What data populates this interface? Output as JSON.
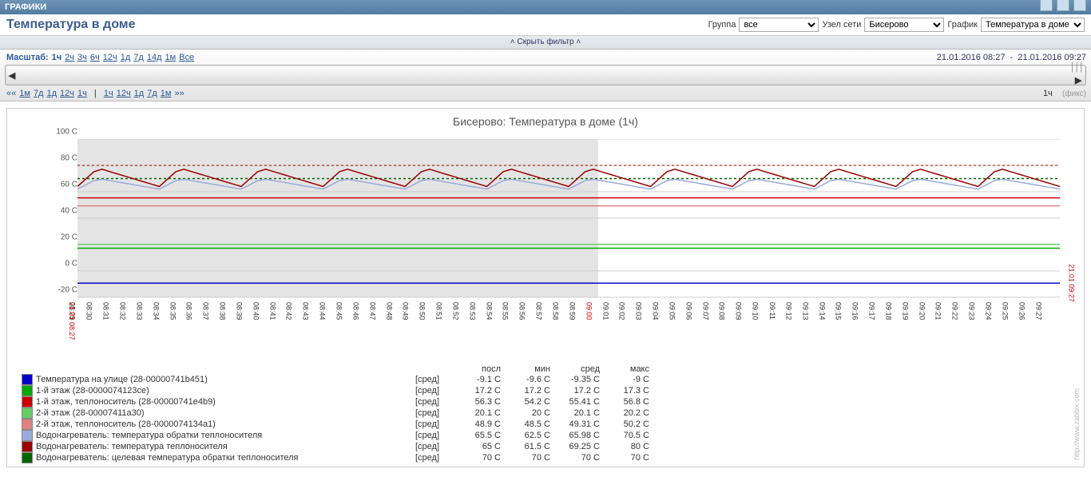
{
  "window_title": "ГРАФИКИ",
  "page_title": "Температура в доме",
  "filters": {
    "group_label": "Группа",
    "group_value": "все",
    "node_label": "Узел сети",
    "node_value": "Бисерово",
    "chart_label": "График",
    "chart_value": "Температура в доме"
  },
  "filterbar_text": "Скрыть фильтр",
  "scale": {
    "label": "Масштаб:",
    "options": [
      "1ч",
      "2ч",
      "3ч",
      "6ч",
      "12ч",
      "1д",
      "7д",
      "14д",
      "1м",
      "Все"
    ],
    "selected": "1ч",
    "date_from": "21.01.2016 08:27",
    "date_sep": "-",
    "date_to": "21.01.2016 09:27"
  },
  "nav2": {
    "back": [
      "««",
      "1м",
      "7д",
      "1д",
      "12ч",
      "1ч"
    ],
    "fwd": [
      "1ч",
      "12ч",
      "1д",
      "7д",
      "1м",
      "»»"
    ],
    "right_label": "1ч",
    "fix": "(фикс)"
  },
  "chart_data": {
    "type": "line",
    "title": "Бисерово: Температура в доме (1ч)",
    "ylabel": "",
    "y_ticks": [
      "-20 C",
      "0 C",
      "20 C",
      "40 C",
      "60 C",
      "80 C",
      "100 C"
    ],
    "ylim": [
      -20,
      100
    ],
    "x_start_label": "21.01 08:27",
    "x_end_label": "21.01 09:27",
    "x_ticks": [
      "08:29",
      "08:30",
      "08:31",
      "08:32",
      "08:33",
      "08:34",
      "08:35",
      "08:36",
      "08:37",
      "08:38",
      "08:39",
      "08:40",
      "08:41",
      "08:42",
      "08:43",
      "08:44",
      "08:45",
      "08:46",
      "08:47",
      "08:48",
      "08:49",
      "08:50",
      "08:51",
      "08:52",
      "08:53",
      "08:54",
      "08:55",
      "08:56",
      "08:57",
      "08:58",
      "08:59",
      "09:00",
      "09:01",
      "09:02",
      "09:03",
      "09:04",
      "09:05",
      "09:06",
      "09:07",
      "09:08",
      "09:09",
      "09:10",
      "09:11",
      "09:12",
      "09:13",
      "09:14",
      "09:15",
      "09:16",
      "09:17",
      "09:18",
      "09:19",
      "09:20",
      "09:21",
      "09:22",
      "09:23",
      "09:24",
      "09:25",
      "09:26",
      "09:27"
    ],
    "x_red_index": 31,
    "shaded_fraction": 0.53,
    "series": [
      {
        "name": "Температура на улице (28-00000741b451)",
        "color": "#0000cc",
        "kind": "[сред]",
        "last": "-9.1 C",
        "min": "-9.6 C",
        "avg": "-9.35 C",
        "max": "-9 C",
        "avg_value": -9.35
      },
      {
        "name": "1-й этаж (28-0000074123ce)",
        "color": "#00aa00",
        "kind": "[сред]",
        "last": "17.2 C",
        "min": "17.2 C",
        "avg": "17.2 C",
        "max": "17.3 C",
        "avg_value": 17.2
      },
      {
        "name": "1-й этаж, теплоноситель (28-00000741e4b9)",
        "color": "#cc0000",
        "kind": "[сред]",
        "last": "56.3 C",
        "min": "54.2 C",
        "avg": "55.41 C",
        "max": "56.8 C",
        "avg_value": 55.41
      },
      {
        "name": "2-й этаж (28-00007411a30)",
        "color": "#66cc66",
        "kind": "[сред]",
        "last": "20.1 C",
        "min": "20 C",
        "avg": "20.1 C",
        "max": "20.2 C",
        "avg_value": 20.1
      },
      {
        "name": "2-й этаж, теплоноситель (28-0000074134a1)",
        "color": "#e08080",
        "kind": "[сред]",
        "last": "48.9 C",
        "min": "48.5 C",
        "avg": "49.31 C",
        "max": "50.2 C",
        "avg_value": 49.31
      },
      {
        "name": "Водонагреватель: температура обратки теплоносителя",
        "color": "#99aadd",
        "kind": "[сред]",
        "last": "65.5 C",
        "min": "62.5 C",
        "avg": "65.98 C",
        "max": "70.5 C",
        "avg_value": 65.98
      },
      {
        "name": "Водонагреватель: температура теплоносителя",
        "color": "#990000",
        "kind": "[сред]",
        "last": "65 C",
        "min": "61.5 C",
        "avg": "69.25 C",
        "max": "80 C",
        "avg_value": 69.25
      },
      {
        "name": "Водонагреватель: целевая температура обратки теплоносителя",
        "color": "#006600",
        "kind": "[сред]",
        "last": "70 C",
        "min": "70 C",
        "avg": "70 C",
        "max": "70 C",
        "avg_value": 70,
        "dash": true
      }
    ],
    "osc_series": {
      "color": "#990000",
      "low": 64,
      "high": 78,
      "period_min": 5,
      "pair_color": "#99aadd",
      "pair_low": 62,
      "pair_high": 70
    },
    "legend_headers": [
      "посл",
      "мин",
      "сред",
      "макс"
    ]
  },
  "zabbix_note": "http://www.zabbix.com"
}
